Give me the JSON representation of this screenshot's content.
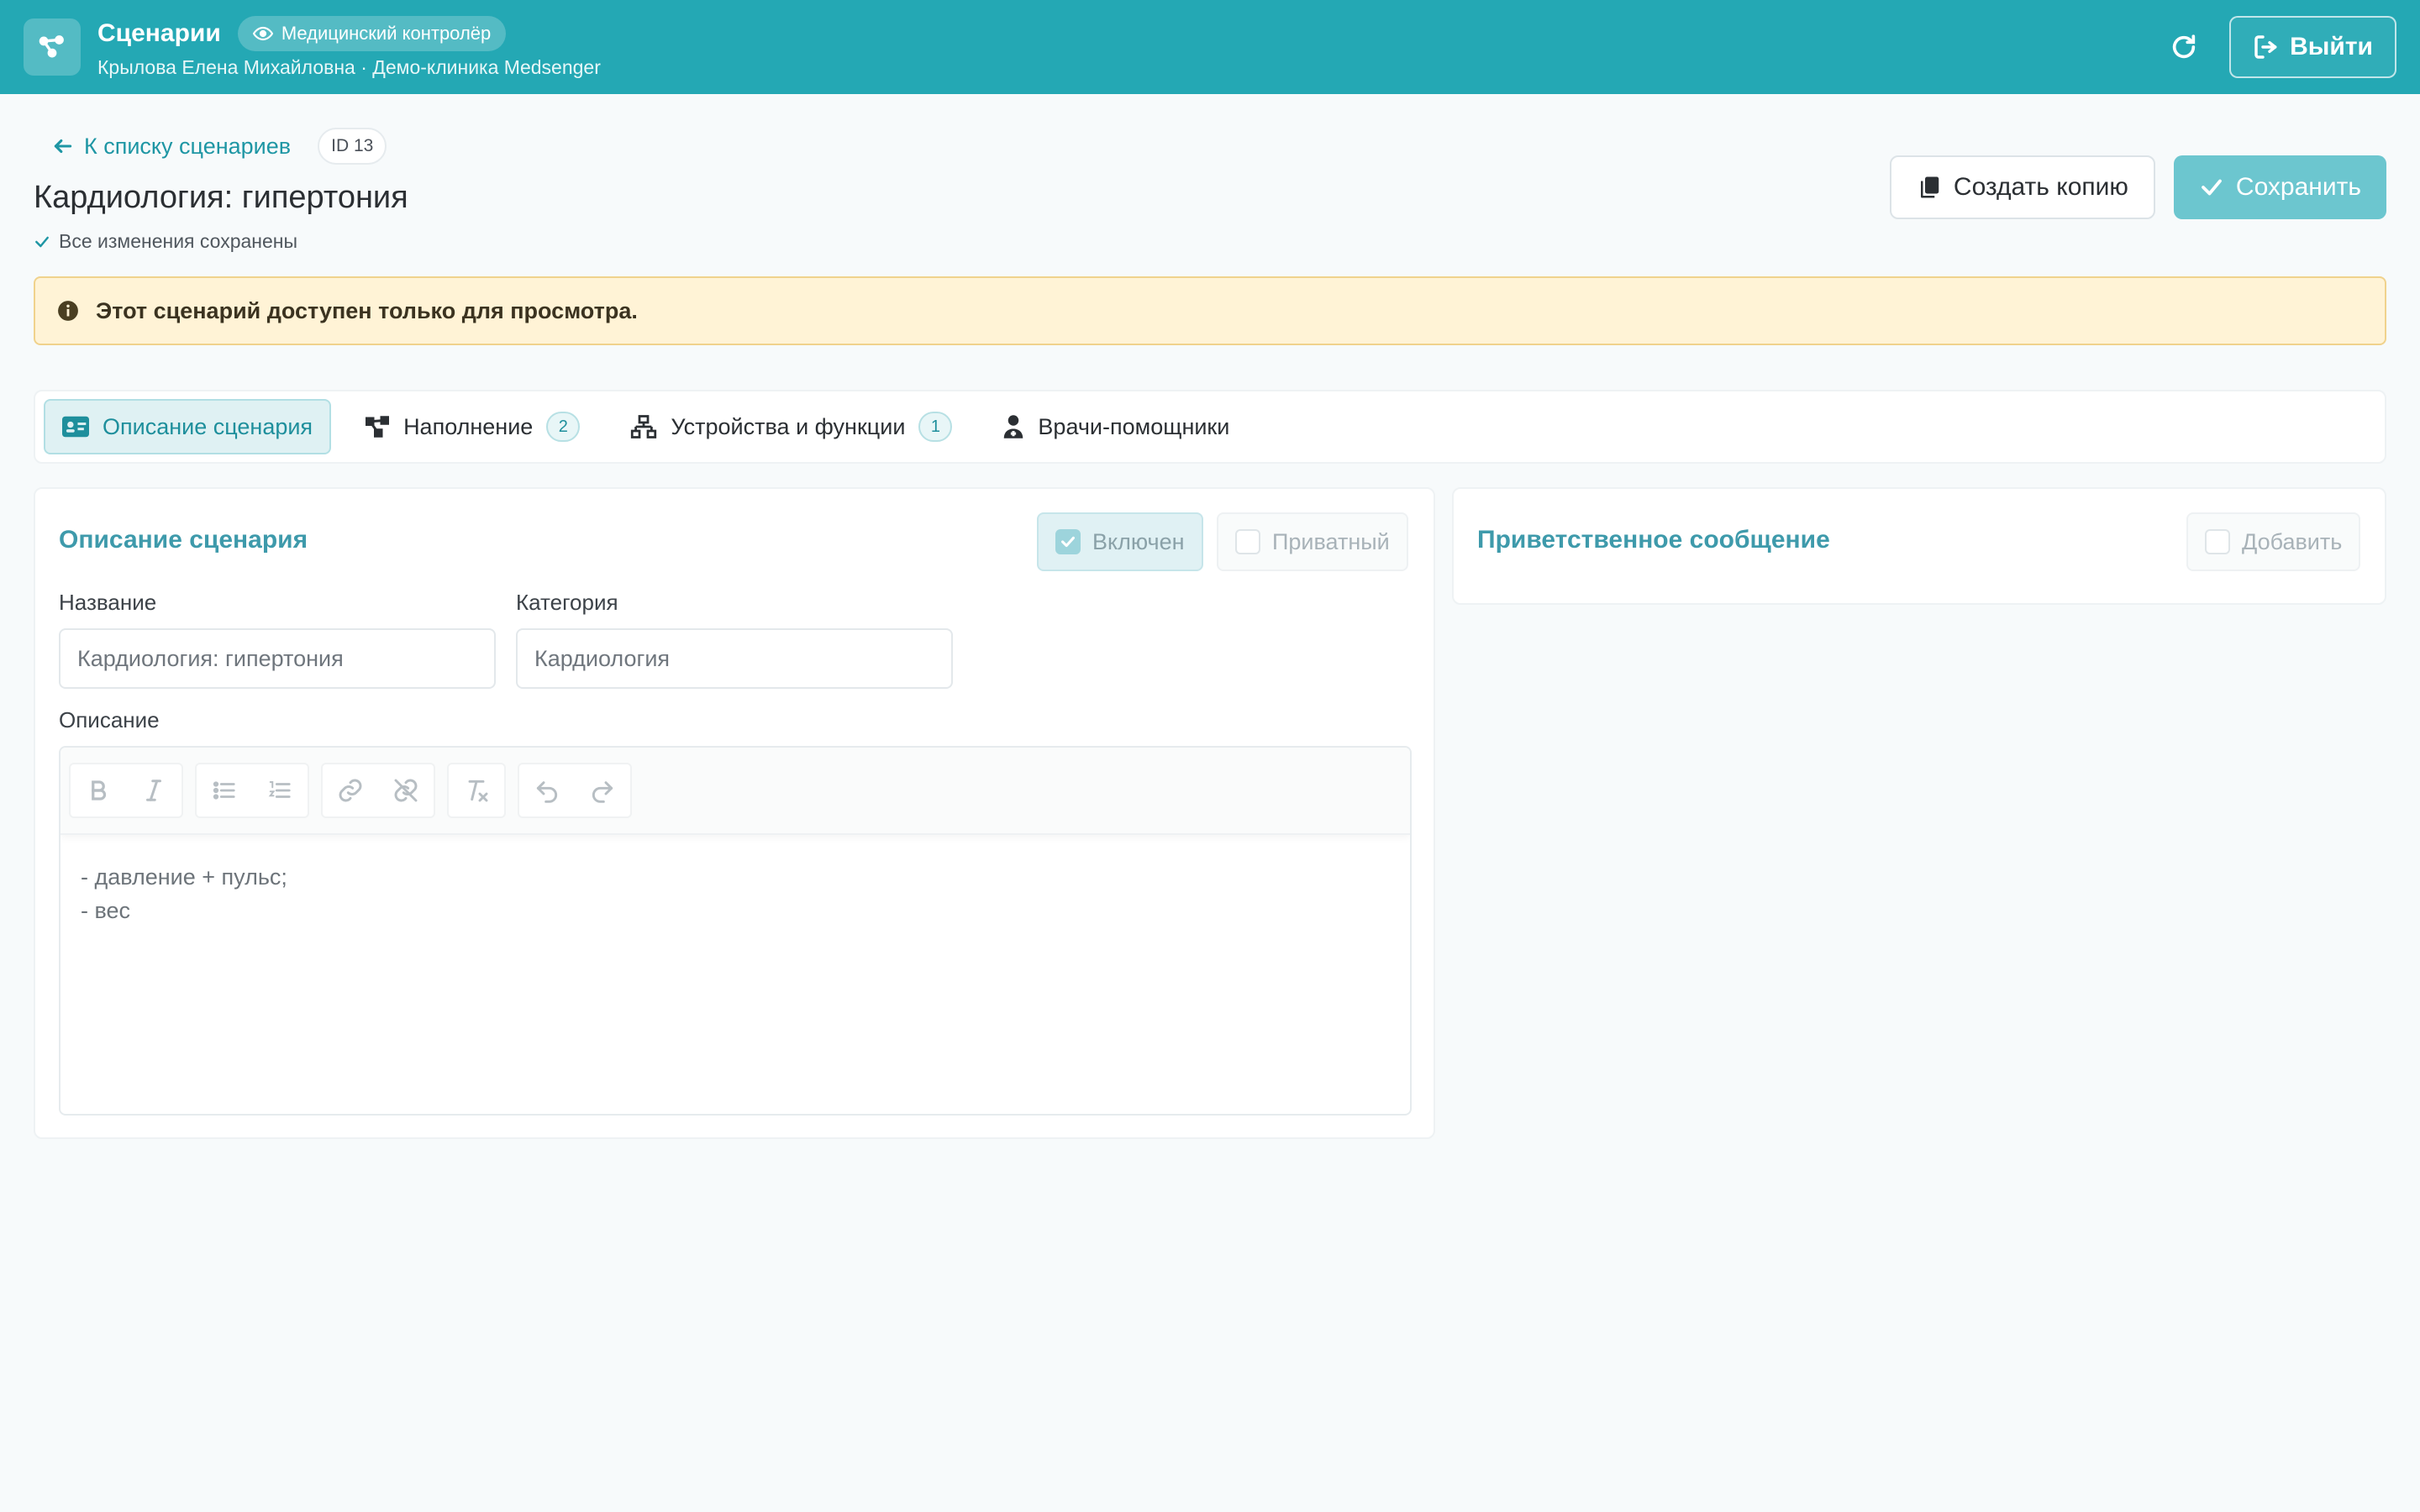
{
  "header": {
    "title": "Сценарии",
    "role_badge": "Медицинский контролёр",
    "user_line": "Крылова Елена Михайловна · Демо-клиника Medsenger",
    "logout_label": "Выйти",
    "accent_color": "#24a8b4"
  },
  "page": {
    "back_label": "К списку сценариев",
    "id_badge": "ID 13",
    "title": "Кардиология: гипертония",
    "saved_status": "Все изменения сохранены",
    "copy_label": "Создать копию",
    "save_label": "Сохранить"
  },
  "alert": {
    "text": "Этот сценарий доступен только для просмотра."
  },
  "tabs": [
    {
      "label": "Описание сценария",
      "icon": "id-card-icon",
      "active": true
    },
    {
      "label": "Наполнение",
      "icon": "nodes-icon",
      "count": "2"
    },
    {
      "label": "Устройства и функции",
      "icon": "network-icon",
      "count": "1"
    },
    {
      "label": "Врачи-помощники",
      "icon": "doctor-icon"
    }
  ],
  "description_card": {
    "title": "Описание сценария",
    "enabled_label": "Включен",
    "enabled_checked": true,
    "private_label": "Приватный",
    "private_checked": false,
    "name_label": "Название",
    "name_value": "Кардиология: гипертония",
    "category_label": "Категория",
    "category_value": "Кардиология",
    "description_label": "Описание",
    "description_lines": [
      "- давление + пульс;",
      "- вес"
    ]
  },
  "greeting_card": {
    "title": "Приветственное сообщение",
    "add_label": "Добавить",
    "add_checked": false
  }
}
